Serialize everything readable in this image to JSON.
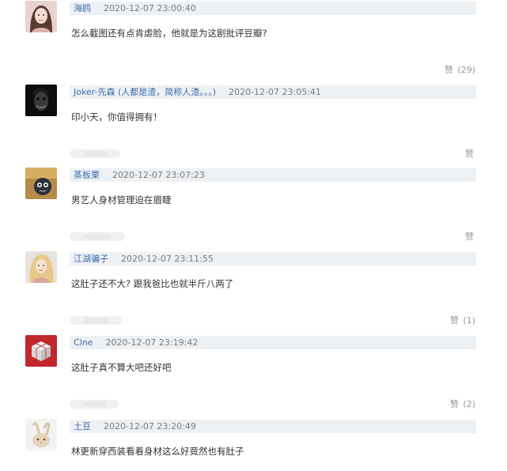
{
  "comments": [
    {
      "user": "海鸥",
      "time": "2020-12-07 23:00:40",
      "text": "怎么截图还有点肯虐脸，他就是为这剧批评豆瓣?",
      "like": "赞",
      "count": "(29)",
      "avatar": "avatar-photo-woman"
    },
    {
      "user": "Joker-先森 (人都是渣，简称人渣。。。)",
      "time": "2020-12-07 23:05:41",
      "text": "印小天，你值得拥有！",
      "like": "赞",
      "count": "",
      "avatar": "avatar-joker"
    },
    {
      "user": "蒸板栗",
      "time": "2020-12-07 23:07:23",
      "text": "男艺人身材管理迫在眉睫",
      "like": "赞",
      "count": "",
      "avatar": "avatar-cartoon"
    },
    {
      "user": "江湖骗子",
      "time": "2020-12-07 23:11:55",
      "text": "这肚子还不大? 跟我爸比也就半斤八两了",
      "like": "赞",
      "count": "(1)",
      "avatar": "avatar-blonde"
    },
    {
      "user": "Clne",
      "time": "2020-12-07 23:19:42",
      "text": "这肚子真不算大吧还好吧",
      "like": "赞",
      "count": "(2)",
      "avatar": "avatar-cube"
    },
    {
      "user": "土豆",
      "time": "2020-12-07 23:20:49",
      "text": "林更新穿西装看着身材这么好竟然也有肚子",
      "like": "",
      "count": "",
      "avatar": "avatar-bunny"
    }
  ],
  "colors": {
    "meta_bg": "#eef1f4",
    "username": "#3b6bb0",
    "text": "#333333",
    "like": "#9a9a9a"
  }
}
